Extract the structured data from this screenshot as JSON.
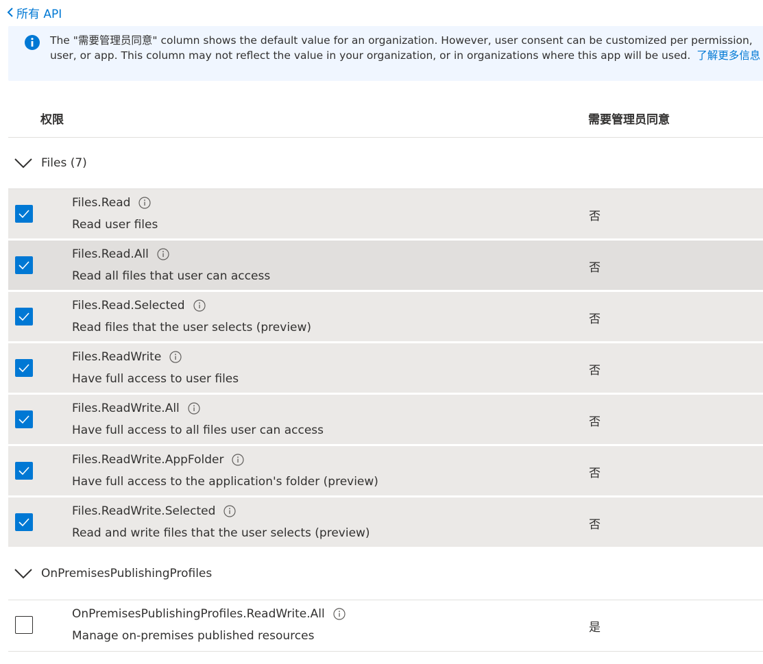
{
  "back_link": {
    "label": "所有 API"
  },
  "banner": {
    "text": "The \"需要管理员同意\" column shows the default value for an organization. However, user consent can be customized per permission,",
    "text2": "user, or app. This column may not reflect the value in your organization, or in organizations where this app will be used.",
    "link": "了解更多信息"
  },
  "table": {
    "columns": {
      "permission": "权限",
      "admin_consent": "需要管理员同意"
    }
  },
  "groups": [
    {
      "title": "Files (7)",
      "permissions": [
        {
          "name": "Files.Read",
          "desc": "Read user files",
          "admin": "否",
          "checked": true
        },
        {
          "name": "Files.Read.All",
          "desc": "Read all files that user can access",
          "admin": "否",
          "checked": true
        },
        {
          "name": "Files.Read.Selected",
          "desc": "Read files that the user selects (preview)",
          "admin": "否",
          "checked": true
        },
        {
          "name": "Files.ReadWrite",
          "desc": "Have full access to user files",
          "admin": "否",
          "checked": true
        },
        {
          "name": "Files.ReadWrite.All",
          "desc": "Have full access to all files user can access",
          "admin": "否",
          "checked": true
        },
        {
          "name": "Files.ReadWrite.AppFolder",
          "desc": "Have full access to the application's folder (preview)",
          "admin": "否",
          "checked": true
        },
        {
          "name": "Files.ReadWrite.Selected",
          "desc": "Read and write files that the user selects (preview)",
          "admin": "否",
          "checked": true
        }
      ]
    },
    {
      "title": "OnPremisesPublishingProfiles",
      "permissions": [
        {
          "name": "OnPremisesPublishingProfiles.ReadWrite.All",
          "desc": "Manage on-premises published resources",
          "admin": "是",
          "checked": false
        }
      ]
    }
  ],
  "colors": {
    "accent": "#0078d4",
    "row_bg": "#ebe9e7",
    "banner_bg": "#f0f6ff"
  }
}
